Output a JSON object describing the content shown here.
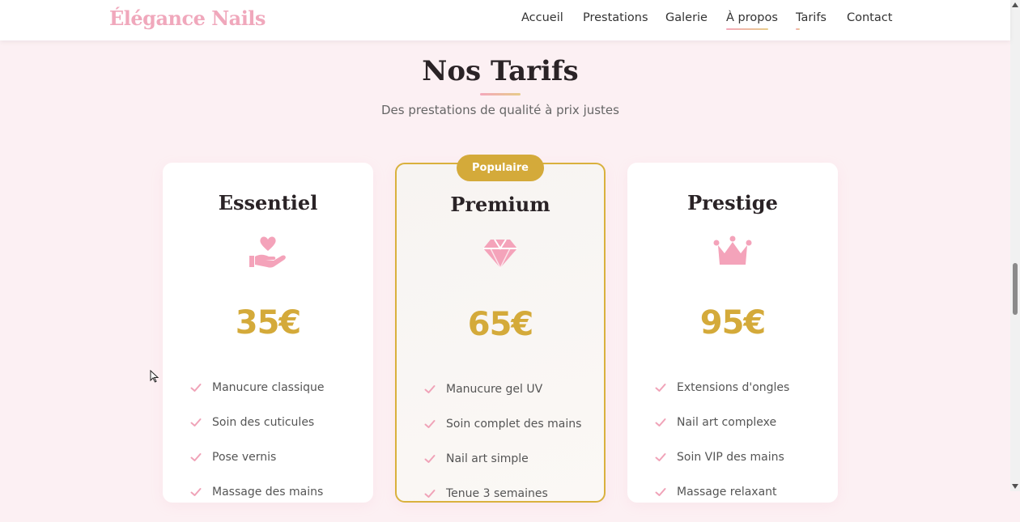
{
  "header": {
    "logo": "Élégance Nails",
    "nav": [
      {
        "label": "Accueil"
      },
      {
        "label": "Prestations"
      },
      {
        "label": "Galerie"
      },
      {
        "label": "À propos"
      },
      {
        "label": "Tarifs"
      },
      {
        "label": "Contact"
      }
    ]
  },
  "section": {
    "title": "Nos Tarifs",
    "subtitle": "Des prestations de qualité à prix justes"
  },
  "cards": [
    {
      "name": "Essentiel",
      "icon": "hand-heart-icon",
      "price": "35€",
      "features": [
        "Manucure classique",
        "Soin des cuticules",
        "Pose vernis",
        "Massage des mains"
      ]
    },
    {
      "name": "Premium",
      "badge": "Populaire",
      "icon": "gem-icon",
      "price": "65€",
      "features": [
        "Manucure gel UV",
        "Soin complet des mains",
        "Nail art simple",
        "Tenue 3 semaines"
      ]
    },
    {
      "name": "Prestige",
      "icon": "crown-icon",
      "price": "95€",
      "features": [
        "Extensions d'ongles",
        "Nail art complexe",
        "Soin VIP des mains",
        "Massage relaxant"
      ]
    }
  ],
  "colors": {
    "background": "#fcf0f3",
    "accent_pink": "#f0a8bc",
    "gold": "#d4aa3a",
    "text_dark": "#2a2326"
  }
}
